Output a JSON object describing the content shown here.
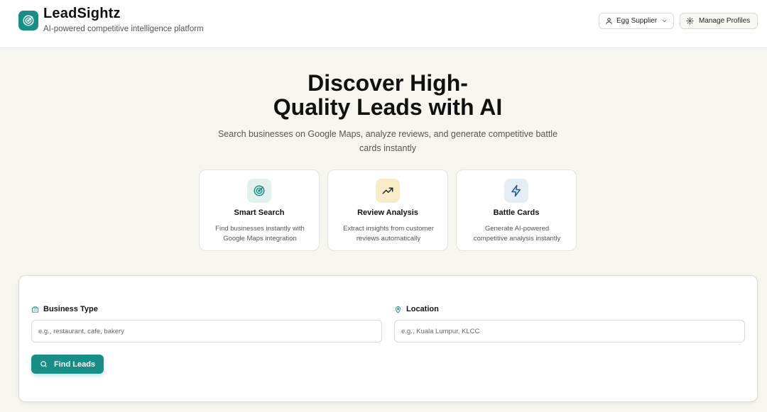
{
  "app": {
    "name": "LeadSightz",
    "tagline": "AI-powered competitive intelligence platform",
    "logo_icon": "target-icon"
  },
  "header": {
    "profile_select": {
      "value": "Egg Supplier",
      "icon": "user-icon"
    },
    "manage_profiles": {
      "label": "Manage Profiles",
      "icon": "gear-icon"
    }
  },
  "hero": {
    "title_line1": "Discover High-",
    "title_line2": "Quality Leads with AI",
    "subtitle_line1": "Search businesses on Google Maps, analyze reviews, and generate competitive battle",
    "subtitle_line2": "cards instantly"
  },
  "features": [
    {
      "title": "Smart Search",
      "desc_line1": "Find businesses instantly with",
      "desc_line2": "Google Maps integration",
      "icon": "target-icon",
      "icon_bg": "#e2f1ef",
      "icon_color": "#178f86"
    },
    {
      "title": "Review Analysis",
      "desc_line1": "Extract insights from customer",
      "desc_line2": "reviews automatically",
      "icon": "trending-up-icon",
      "icon_bg": "#f7ecc8",
      "icon_color": "#1f2a2a"
    },
    {
      "title": "Battle Cards",
      "desc_line1": "Generate AI-powered",
      "desc_line2": "competitive analysis instantly",
      "icon": "lightning-icon",
      "icon_bg": "#e4edf6",
      "icon_color": "#1f5d8c"
    }
  ],
  "search": {
    "business_type": {
      "label": "Business Type",
      "placeholder": "e.g., restaurant, cafe, bakery",
      "value": "",
      "icon": "building-icon"
    },
    "location": {
      "label": "Location",
      "placeholder": "e.g., Kuala Lumpur, KLCC",
      "value": "",
      "icon": "map-pin-icon"
    },
    "submit": {
      "label": "Find Leads",
      "icon": "search-icon"
    }
  },
  "colors": {
    "accent": "#178f86",
    "background": "#f6f5ef"
  }
}
